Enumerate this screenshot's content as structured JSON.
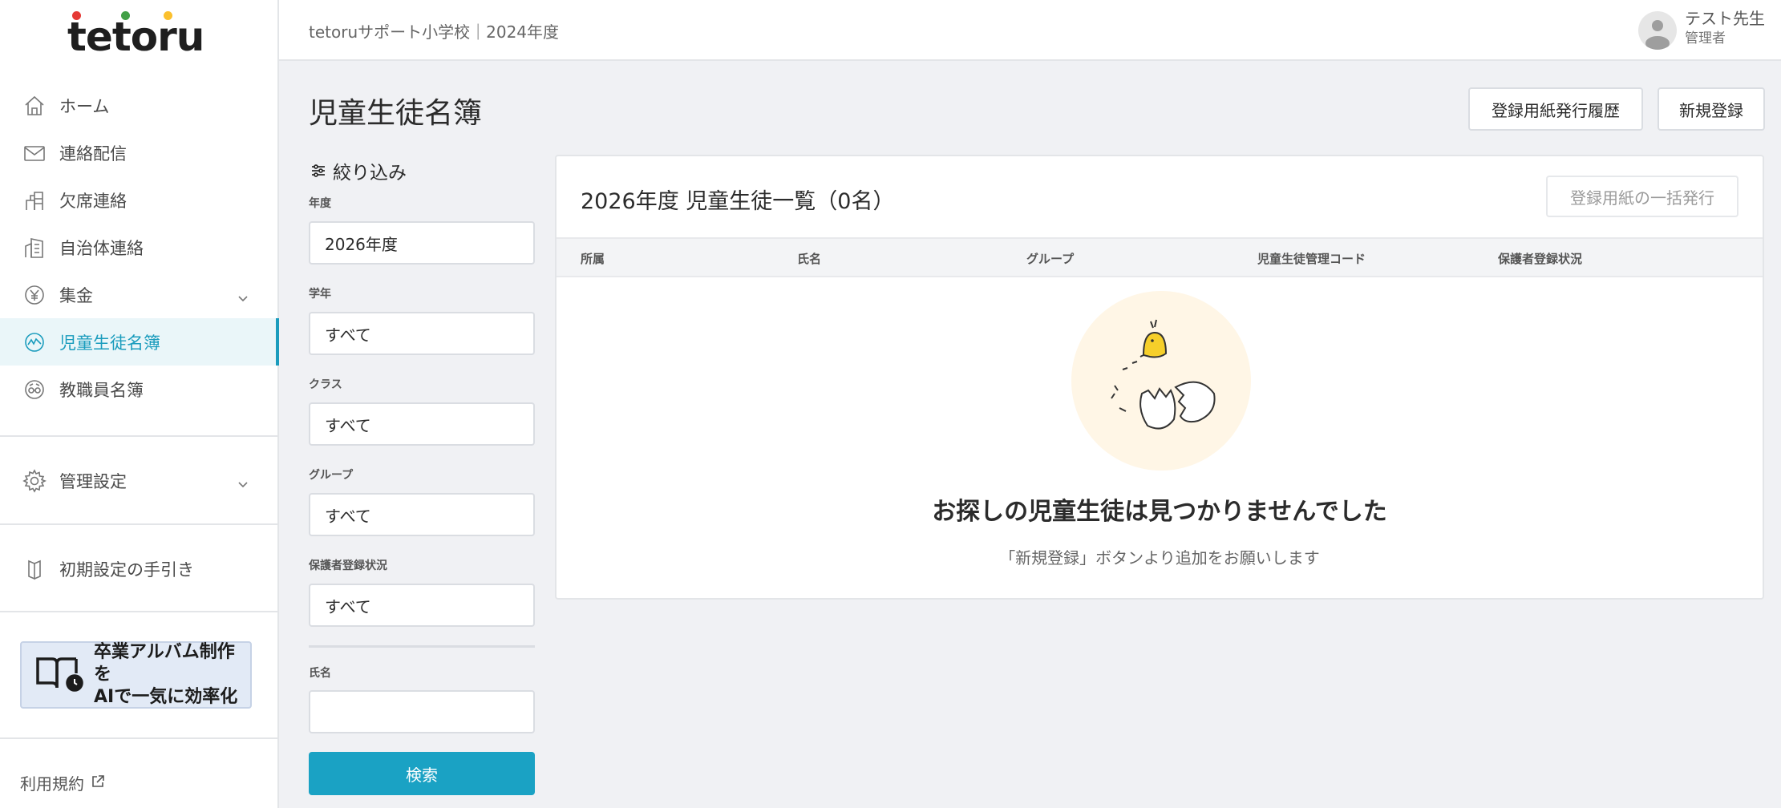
{
  "app": {
    "logo_text": "tetoru",
    "logo_dot_colors": [
      "#e53935",
      "#43a047",
      "#fbc02d"
    ]
  },
  "header": {
    "school": "tetoruサポート小学校｜2024年度",
    "user_name": "テスト先生",
    "user_role": "管理者"
  },
  "sidebar": {
    "items": [
      {
        "label": "ホーム",
        "icon": "home-icon"
      },
      {
        "label": "連絡配信",
        "icon": "mail-icon"
      },
      {
        "label": "欠席連絡",
        "icon": "absence-icon"
      },
      {
        "label": "自治体連絡",
        "icon": "building-icon"
      },
      {
        "label": "集金",
        "icon": "yen-icon",
        "has_submenu": true
      },
      {
        "label": "児童生徒名簿",
        "icon": "student-roster-icon",
        "active": true
      },
      {
        "label": "教職員名簿",
        "icon": "staff-roster-icon"
      }
    ],
    "settings": {
      "label": "管理設定",
      "icon": "gear-icon"
    },
    "guide": {
      "label": "初期設定の手引き",
      "icon": "book-icon"
    },
    "banner": {
      "line1": "卒業アルバム制作を",
      "line2": "AIで一気に効率化"
    },
    "terms": "利用規約"
  },
  "main": {
    "title": "児童生徒名簿",
    "buttons": {
      "history": "登録用紙発行履歴",
      "new": "新規登録"
    },
    "filter": {
      "heading": "絞り込み",
      "year_label": "年度",
      "year_value": "2026年度",
      "grade_label": "学年",
      "grade_value": "すべて",
      "class_label": "クラス",
      "class_value": "すべて",
      "group_label": "グループ",
      "group_value": "すべて",
      "guardian_label": "保護者登録状況",
      "guardian_value": "すべて",
      "name_label": "氏名",
      "name_value": "",
      "search_button": "検索"
    },
    "list": {
      "title": "2026年度 児童生徒一覧（0名）",
      "bulk_button": "登録用紙の一括発行",
      "columns": [
        "所属",
        "氏名",
        "グループ",
        "児童生徒管理コード",
        "保護者登録状況"
      ],
      "empty_title": "お探しの児童生徒は見つかりませんでした",
      "empty_sub": "「新規登録」ボタンより追加をお願いします"
    }
  },
  "colors": {
    "accent": "#1aa2c4",
    "active_bg": "#eaf6f9",
    "banner_bg": "#e2eaf6"
  }
}
